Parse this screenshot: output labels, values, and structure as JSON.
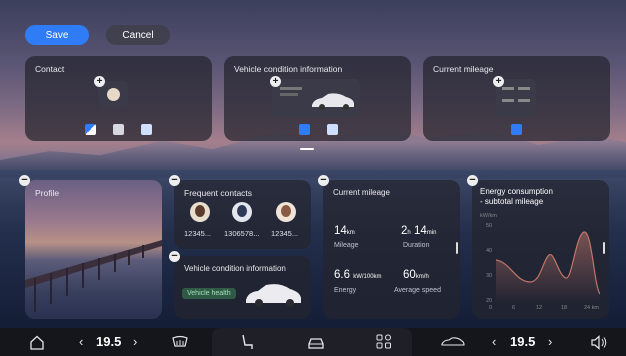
{
  "top_bar": {
    "save_label": "Save",
    "cancel_label": "Cancel"
  },
  "library_cards": {
    "contact": {
      "title": "Contact"
    },
    "vehicle_condition": {
      "title": "Vehicle condition information"
    },
    "current_mileage": {
      "title": "Current mileage"
    }
  },
  "profile": {
    "title": "Profile"
  },
  "frequent_contacts": {
    "title": "Frequent contacts",
    "contacts": [
      {
        "number": "12345..."
      },
      {
        "number": "1306578..."
      },
      {
        "number": "12345..."
      }
    ]
  },
  "vehicle_condition_widget": {
    "title": "Vehicle condition information",
    "health_label": "Vehicle health"
  },
  "mileage_widget": {
    "title": "Current mileage",
    "mileage_value": "14",
    "mileage_unit": "km",
    "mileage_label": "Mileage",
    "duration_h": "2",
    "duration_h_unit": "h",
    "duration_min": "14",
    "duration_min_unit": "min",
    "duration_label": "Duration",
    "energy_value": "6.6",
    "energy_unit": "kW/100km",
    "energy_label": "Energy",
    "speed_value": "60",
    "speed_unit": "km/h",
    "speed_label": "Average speed"
  },
  "energy_widget": {
    "title_line1": "Energy consumption",
    "title_line2": "- subtotal mileage",
    "y_unit": "kW/km",
    "y_ticks": [
      "50",
      "40",
      "30",
      "20"
    ],
    "x_ticks": [
      "0",
      "6",
      "12",
      "18",
      "24 km"
    ]
  },
  "dock": {
    "left_temp": "19.5",
    "right_temp": "19.5"
  },
  "colors": {
    "accent": "#2f7cf6",
    "card_bg": "rgba(36,36,46,0.72)",
    "curve": "#c0766a"
  }
}
